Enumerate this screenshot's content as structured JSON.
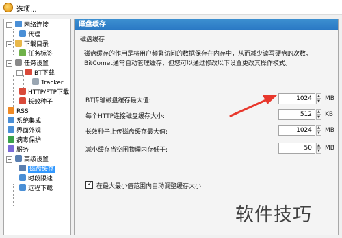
{
  "window": {
    "title": "选项..."
  },
  "tree": {
    "items": [
      {
        "label": "网络连接",
        "icon": "network-icon",
        "color": "#4a8fd6"
      },
      {
        "label": "代理",
        "icon": "proxy-icon",
        "color": "#4a8fd6"
      },
      {
        "label": "下载目录",
        "icon": "folder-icon",
        "color": "#e9b84a"
      },
      {
        "label": "任务标签",
        "icon": "tag-icon",
        "color": "#6fb24a"
      },
      {
        "label": "任务设置",
        "icon": "task-settings-icon",
        "color": "#8a8a8a"
      },
      {
        "label": "BT下载",
        "icon": "bt-download-icon",
        "color": "#d94a3a"
      },
      {
        "label": "Tracker",
        "icon": "tracker-icon",
        "color": "#9aa6b2"
      },
      {
        "label": "HTTP/FTP下载",
        "icon": "http-ftp-icon",
        "color": "#d94a3a"
      },
      {
        "label": "长效种子",
        "icon": "long-term-seed-icon",
        "color": "#d94a3a"
      },
      {
        "label": "RSS",
        "icon": "rss-icon",
        "color": "#f08a24"
      },
      {
        "label": "系统集成",
        "icon": "system-integration-icon",
        "color": "#4a8fd6"
      },
      {
        "label": "界面外观",
        "icon": "appearance-icon",
        "color": "#4a8fd6"
      },
      {
        "label": "病毒保护",
        "icon": "virus-protection-icon",
        "color": "#3aa24a"
      },
      {
        "label": "服务",
        "icon": "service-icon",
        "color": "#7a6ad6"
      },
      {
        "label": "高级设置",
        "icon": "advanced-settings-icon",
        "color": "#5a7fb0"
      },
      {
        "label": "磁盘缓存",
        "icon": "disk-cache-icon",
        "color": "#5a7fb0"
      },
      {
        "label": "时段限速",
        "icon": "time-limit-icon",
        "color": "#4a8fd6"
      },
      {
        "label": "远程下载",
        "icon": "remote-download-icon",
        "color": "#4a8fd6"
      }
    ]
  },
  "panel": {
    "header": "磁盘缓存",
    "section": "磁盘缓存",
    "description": "磁盘缓存的作用是将用户频繁访问的数据保存在内存中，从而减少读写硬盘的次数。BitComet通常自动管理缓存，但您可以通过修改以下设置更改其操作模式。",
    "settings": [
      {
        "label": "BT传输磁盘缓存最大值:",
        "value": "1024",
        "unit": "MB"
      },
      {
        "label": "每个HTTP连接磁盘缓存大小:",
        "value": "512",
        "unit": "KB"
      },
      {
        "label": "长效种子上传磁盘缓存最大值:",
        "value": "1024",
        "unit": "MB"
      },
      {
        "label": "减小缓存当空闲物理内存低于:",
        "value": "50",
        "unit": "MB"
      }
    ],
    "auto_adjust": {
      "label": "在最大最小值范围内自动调整缓存大小",
      "checked": true
    }
  },
  "watermark": "软件技巧",
  "colors": {
    "accent": "#2a78c4",
    "selection": "#3399ff",
    "arrow": "#e8372c"
  }
}
